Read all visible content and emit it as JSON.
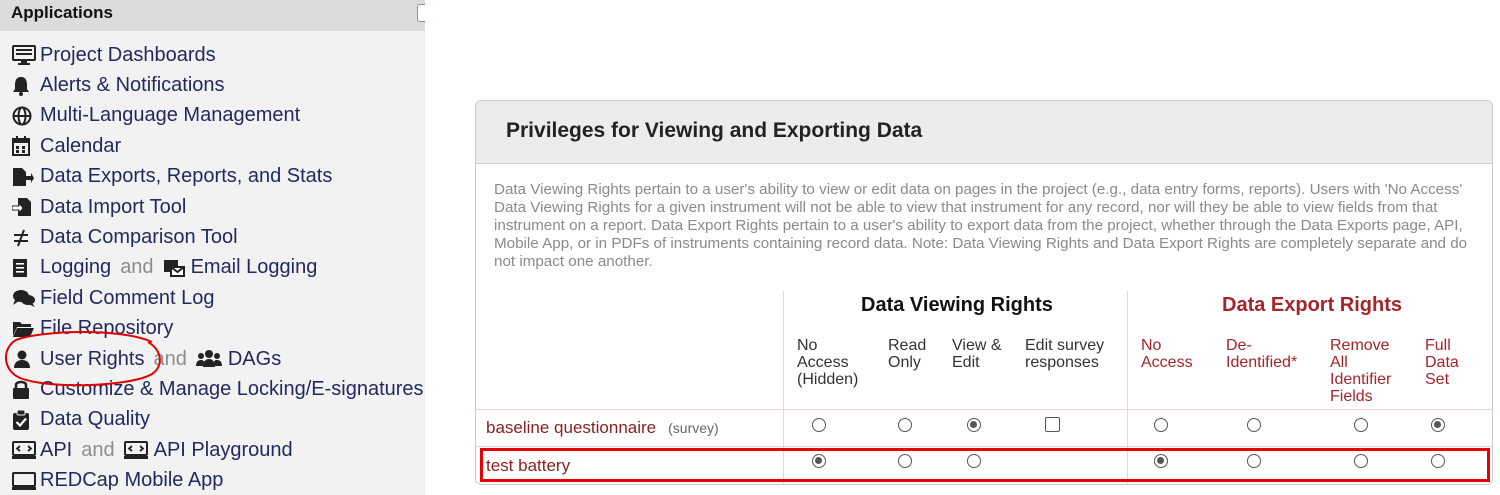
{
  "sidebar": {
    "title": "Applications",
    "items": [
      {
        "icon": "dashboard-icon",
        "label": "Project Dashboards"
      },
      {
        "icon": "bell-icon",
        "label": "Alerts & Notifications"
      },
      {
        "icon": "globe-icon",
        "label": "Multi-Language Management"
      },
      {
        "icon": "calendar-icon",
        "label": "Calendar"
      },
      {
        "icon": "file-export-icon",
        "label": "Data Exports, Reports, and Stats"
      },
      {
        "icon": "file-import-icon",
        "label": "Data Import Tool"
      },
      {
        "icon": "not-equal-icon",
        "label": "Data Comparison Tool"
      },
      {
        "icon": "log-icon",
        "label": "Logging",
        "connector": "and",
        "second_icon": "email-log-icon",
        "second_label": "Email Logging"
      },
      {
        "icon": "comments-icon",
        "label": "Field Comment Log"
      },
      {
        "icon": "folder-icon",
        "label": "File Repository"
      },
      {
        "icon": "user-icon",
        "label": "User Rights",
        "connector": "and",
        "second_icon": "users-icon",
        "second_label": "DAGs"
      },
      {
        "icon": "lock-icon",
        "label": "Customize & Manage Locking/E-signatures"
      },
      {
        "icon": "clipboard-check-icon",
        "label": "Data Quality"
      },
      {
        "icon": "api-icon",
        "label": "API",
        "connector": "and",
        "second_icon": "api-icon",
        "second_label": "API Playground"
      },
      {
        "icon": "mobile-icon",
        "label": "REDCap Mobile App"
      }
    ]
  },
  "panel": {
    "title": "Privileges for Viewing and Exporting Data",
    "description": "Data Viewing Rights pertain to a user's ability to view or edit data on pages in the project (e.g., data entry forms, reports). Users with 'No Access' Data Viewing Rights for a given instrument will not be able to view that instrument for any record, nor will they be able to view fields from that instrument on a report. Data Export Rights pertain to a user's ability to export data from the project, whether through the Data Exports page, API, Mobile App, or in PDFs of instruments containing record data. Note: Data Viewing Rights and Data Export Rights are completely separate and do not impact one another.",
    "viewing_title": "Data Viewing Rights",
    "export_title": "Data Export Rights",
    "viewing_columns": [
      "No Access (Hidden)",
      "Read Only",
      "View & Edit",
      "Edit survey responses"
    ],
    "export_columns": [
      "No Access",
      "De-Identified*",
      "Remove All Identifier Fields",
      "Full Data Set"
    ],
    "rows": [
      {
        "name": "baseline questionnaire",
        "tag": "(survey)",
        "viewing": "View & Edit",
        "edit_survey_responses": false,
        "export": "Full Data Set"
      },
      {
        "name": "test battery",
        "tag": "",
        "viewing": "No Access (Hidden)",
        "export": "No Access"
      }
    ]
  },
  "colors": {
    "accent_red": "#a3262b",
    "annotation_red": "#e60000",
    "link_navy": "#23295e"
  }
}
